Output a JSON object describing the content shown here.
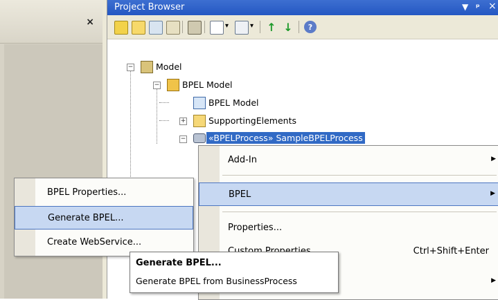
{
  "left_panel": {
    "close_glyph": "×"
  },
  "project_browser": {
    "title": "Project Browser",
    "controls": {
      "dropdown": "▼",
      "pin": "ꟷ",
      "close": "×"
    },
    "toolbar": {
      "buttons": [
        {
          "icon": "new-package-icon"
        },
        {
          "icon": "new-folder-icon"
        },
        {
          "icon": "new-diagram-icon"
        },
        {
          "icon": "new-element-icon"
        },
        {
          "icon": "find-icon"
        },
        {
          "icon": "document-icon"
        },
        {
          "icon": "output-icon"
        },
        {
          "icon": "move-up-icon"
        },
        {
          "icon": "move-down-icon"
        },
        {
          "icon": "help-icon"
        }
      ],
      "dropdown_glyph": "▾"
    },
    "tree": {
      "model": "Model",
      "bpel_model": "BPEL Model",
      "bpel_model_diagram": "BPEL Model",
      "supporting_elements": "SupportingElements",
      "sample_process": "«BPELProcess» SampleBPELProcess"
    }
  },
  "context_menu": {
    "items": [
      {
        "label": "Add-In",
        "submenu": true
      },
      {
        "label": "BPEL",
        "submenu": true,
        "highlighted": true
      },
      {
        "label": "Properties...",
        "submenu": false
      },
      {
        "label": "Custom Properties",
        "shortcut": "Ctrl+Shift+Enter"
      }
    ],
    "arrow": "▶"
  },
  "bpel_submenu": {
    "items": [
      {
        "label": "BPEL Properties..."
      },
      {
        "label": "Generate BPEL...",
        "highlighted": true
      },
      {
        "label": "Create WebService..."
      }
    ]
  },
  "tooltip": {
    "title": "Generate BPEL...",
    "description": "Generate BPEL from BusinessProcess"
  },
  "colors": {
    "title_bar": "#2d5fc6",
    "selection": "#316ac5",
    "menu_highlight": "#c7d8f2",
    "menu_highlight_border": "#4b75c1"
  }
}
